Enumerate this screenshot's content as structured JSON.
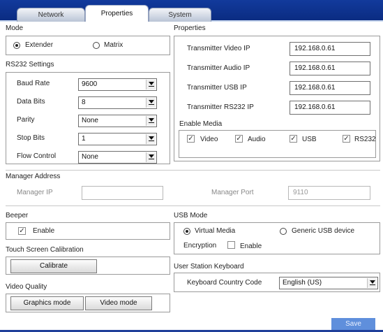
{
  "tabs": [
    {
      "label": "Network"
    },
    {
      "label": "Properties"
    },
    {
      "label": "System"
    }
  ],
  "mode": {
    "title": "Mode",
    "options": [
      "Extender",
      "Matrix"
    ],
    "selected": "Extender"
  },
  "rs232": {
    "title": "RS232 Settings",
    "rows": [
      {
        "label": "Baud Rate",
        "value": "9600"
      },
      {
        "label": "Data Bits",
        "value": "8"
      },
      {
        "label": "Parity",
        "value": "None"
      },
      {
        "label": "Stop Bits",
        "value": "1"
      },
      {
        "label": "Flow Control",
        "value": "None"
      }
    ]
  },
  "properties": {
    "title": "Properties",
    "rows": [
      {
        "label": "Transmitter Video IP",
        "value": "192.168.0.61"
      },
      {
        "label": "Transmitter Audio IP",
        "value": "192.168.0.61"
      },
      {
        "label": "Transmitter USB IP",
        "value": "192.168.0.61"
      },
      {
        "label": "Transmitter RS232 IP",
        "value": "192.168.0.61"
      }
    ],
    "enable_media_title": "Enable Media",
    "media": [
      {
        "label": "Video",
        "checked": true
      },
      {
        "label": "Audio",
        "checked": true
      },
      {
        "label": "USB",
        "checked": true
      },
      {
        "label": "RS232",
        "checked": true
      }
    ]
  },
  "manager": {
    "title": "Manager Address",
    "ip_label": "Manager IP",
    "ip_value": "",
    "port_label": "Manager Port",
    "port_value": "9110"
  },
  "beeper": {
    "title": "Beeper",
    "enable_label": "Enable",
    "checked": true
  },
  "touch": {
    "title": "Touch Screen Calibration",
    "button": "Calibrate"
  },
  "video_quality": {
    "title": "Video Quality",
    "buttons": [
      "Graphics mode",
      "Video mode"
    ]
  },
  "usb_mode": {
    "title": "USB Mode",
    "options": [
      "Virtual Media",
      "Generic USB device"
    ],
    "selected": "Virtual Media",
    "encryption_label": "Encryption",
    "encryption_enable_label": "Enable",
    "encryption_checked": false
  },
  "keyboard": {
    "title": "User Station Keyboard",
    "code_label": "Keyboard Country Code",
    "code_value": "English (US)"
  },
  "save_label": "Save",
  "colors": {
    "tab_bar": "#123a9c",
    "save_button": "#5f8fdc"
  }
}
